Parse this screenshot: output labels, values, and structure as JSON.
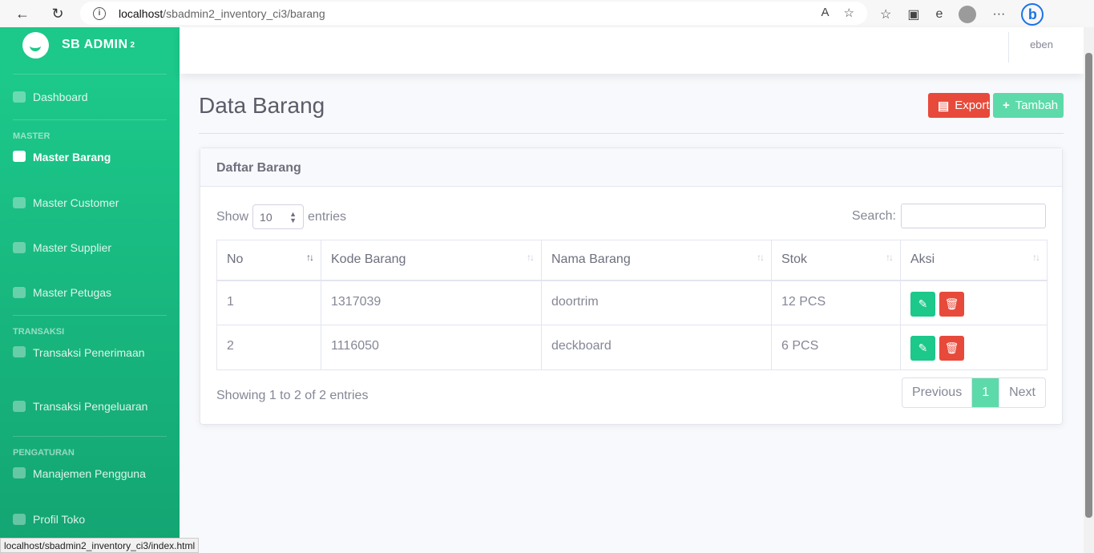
{
  "browser": {
    "url_host": "localhost",
    "url_path": "/sbadmin2_inventory_ci3/barang",
    "status_url": "localhost/sbadmin2_inventory_ci3/index.html"
  },
  "brand": {
    "name": "SB ADMIN",
    "sup": "2"
  },
  "sidebar": {
    "dashboard": "Dashboard",
    "heading_master": "MASTER",
    "master_items": [
      "Master Barang",
      "Master Customer",
      "Master Supplier",
      "Master Petugas"
    ],
    "heading_transaksi": "TRANSAKSI",
    "transaksi_items": [
      "Transaksi Penerimaan",
      "Transaksi Pengeluaran"
    ],
    "heading_pengaturan": "PENGATURAN",
    "pengaturan_items": [
      "Manajemen Pengguna",
      "Profil Toko"
    ]
  },
  "topbar": {
    "user": "eben"
  },
  "page": {
    "title": "Data Barang",
    "export_label": "Export",
    "tambah_label": "Tambah"
  },
  "card": {
    "title": "Daftar Barang",
    "show_label": "Show",
    "entries_label": "entries",
    "page_size": "10",
    "search_label": "Search:",
    "columns": [
      "No",
      "Kode Barang",
      "Nama Barang",
      "Stok",
      "Aksi"
    ],
    "rows": [
      {
        "no": "1",
        "kode": "1317039",
        "nama": "doortrim",
        "stok": "12 PCS"
      },
      {
        "no": "2",
        "kode": "1116050",
        "nama": "deckboard",
        "stok": "6 PCS"
      }
    ],
    "info": "Showing 1 to 2 of 2 entries",
    "prev": "Previous",
    "current_page": "1",
    "next": "Next"
  },
  "colors": {
    "primary_green": "#1cc88a",
    "danger": "#e74a3b",
    "light_green": "#5ddaa9"
  }
}
